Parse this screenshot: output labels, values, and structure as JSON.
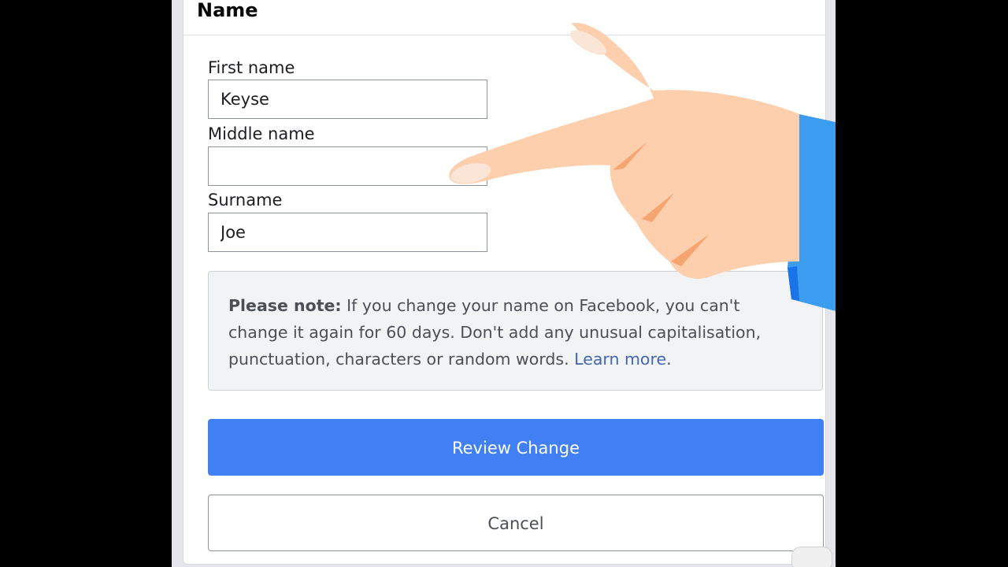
{
  "section": {
    "title": "Name"
  },
  "fields": {
    "first_name_label": "First name",
    "first_name_value": "Keyse",
    "middle_name_label": "Middle name",
    "middle_name_value": "",
    "surname_label": "Surname",
    "surname_value": "Joe"
  },
  "note": {
    "bold_prefix": "Please note:",
    "body": " If you change your name on Facebook, you can't change it again for 60 days. Don't add any unusual capitalisation, punctuation, characters or random words. ",
    "link_text": "Learn more",
    "suffix": "."
  },
  "buttons": {
    "review_label": "Review Change",
    "cancel_label": "Cancel"
  },
  "colors": {
    "primary": "#4080f4",
    "link": "#4267b2",
    "note_background": "#f2f3f5",
    "hand_skin": "#fdcfad",
    "sleeve": "#3c9cf0"
  },
  "overlay": {
    "icon": "pointing-hand-icon"
  }
}
